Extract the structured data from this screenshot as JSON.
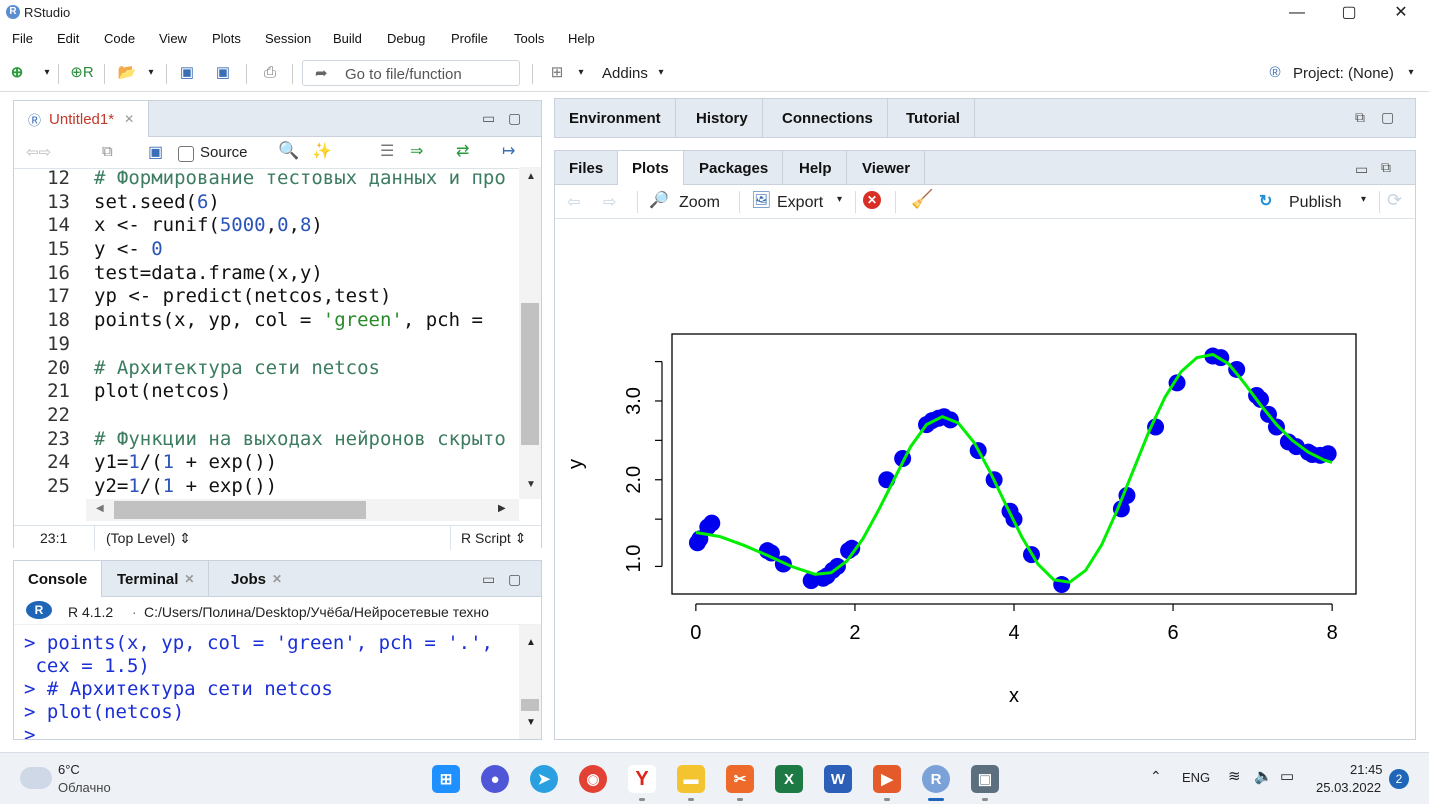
{
  "app": {
    "title": "RStudio",
    "logo_letter": "R"
  },
  "window_controls": {
    "minimize": "—",
    "maximize": "▢",
    "close": "✕"
  },
  "menu": [
    "File",
    "Edit",
    "Code",
    "View",
    "Plots",
    "Session",
    "Build",
    "Debug",
    "Profile",
    "Tools",
    "Help"
  ],
  "toolbar": {
    "goto_placeholder": "Go to file/function",
    "addins_label": "Addins",
    "project_label": "Project: (None)"
  },
  "editor": {
    "tab_label": "Untitled1*",
    "source_checkbox_label": "Source",
    "lines": [
      {
        "n": "12",
        "text": "# Формирование тестовых данных и про"
      },
      {
        "n": "13",
        "text": "set.seed(6)"
      },
      {
        "n": "14",
        "text": "x <- runif(5000,0,8)"
      },
      {
        "n": "15",
        "text": "y <- 0"
      },
      {
        "n": "16",
        "text": "test=data.frame(x,y)"
      },
      {
        "n": "17",
        "text": "yp <- predict(netcos,test)"
      },
      {
        "n": "18",
        "text": "points(x, yp, col = 'green', pch = "
      },
      {
        "n": "19",
        "text": ""
      },
      {
        "n": "20",
        "text": "# Архитектура сети netcos"
      },
      {
        "n": "21",
        "text": "plot(netcos)"
      },
      {
        "n": "22",
        "text": ""
      },
      {
        "n": "23",
        "text": "# Функции на выходах нейронов скрыто"
      },
      {
        "n": "24",
        "text": "y1=1/(1 + exp())"
      },
      {
        "n": "25",
        "text": "y2=1/(1 + exp())"
      },
      {
        "n": "26",
        "text": ""
      }
    ],
    "status_position": "23:1",
    "status_scope": "(Top Level) ⇕",
    "status_type": "R Script ⇕"
  },
  "console": {
    "tabs": [
      "Console",
      "Terminal",
      "Jobs"
    ],
    "r_version": "R 4.1.2",
    "path": "C:/Users/Полина/Desktop/Учёба/Нейросетевые техно",
    "lines": [
      "> points(x, yp, col = 'green', pch = '.',",
      " cex = 1.5)",
      "> # Архитектура сети netcos",
      "> plot(netcos)",
      ">"
    ]
  },
  "env_tabs": [
    "Environment",
    "History",
    "Connections",
    "Tutorial"
  ],
  "plot_tabs": [
    "Files",
    "Plots",
    "Packages",
    "Help",
    "Viewer"
  ],
  "plot_toolbar": {
    "zoom": "Zoom",
    "export": "Export",
    "publish": "Publish"
  },
  "chart_data": {
    "type": "scatter",
    "xlabel": "x",
    "ylabel": "y",
    "xlim": [
      -0.3,
      8.3
    ],
    "ylim": [
      0.55,
      3.85
    ],
    "xticks": [
      "0",
      "2",
      "4",
      "6",
      "8"
    ],
    "yticks": [
      "1.0",
      "2.0",
      "3.0"
    ],
    "point_color": "#0000ee",
    "line_color": "#00ee00",
    "series": [
      {
        "type": "scatter",
        "points": [
          [
            0.02,
            1.2
          ],
          [
            0.05,
            1.25
          ],
          [
            0.15,
            1.4
          ],
          [
            0.2,
            1.45
          ],
          [
            0.9,
            1.1
          ],
          [
            0.95,
            1.07
          ],
          [
            1.1,
            0.93
          ],
          [
            1.45,
            0.72
          ],
          [
            1.6,
            0.75
          ],
          [
            1.65,
            0.78
          ],
          [
            1.72,
            0.85
          ],
          [
            1.78,
            0.9
          ],
          [
            1.92,
            1.1
          ],
          [
            1.96,
            1.13
          ],
          [
            2.4,
            2.0
          ],
          [
            2.6,
            2.27
          ],
          [
            2.9,
            2.7
          ],
          [
            2.97,
            2.75
          ],
          [
            3.05,
            2.78
          ],
          [
            3.12,
            2.8
          ],
          [
            3.2,
            2.76
          ],
          [
            3.55,
            2.37
          ],
          [
            3.75,
            2.0
          ],
          [
            3.95,
            1.6
          ],
          [
            4.0,
            1.5
          ],
          [
            4.22,
            1.05
          ],
          [
            4.6,
            0.67
          ],
          [
            5.35,
            1.63
          ],
          [
            5.42,
            1.8
          ],
          [
            5.78,
            2.67
          ],
          [
            6.05,
            3.23
          ],
          [
            6.5,
            3.57
          ],
          [
            6.6,
            3.55
          ],
          [
            6.8,
            3.4
          ],
          [
            7.05,
            3.07
          ],
          [
            7.1,
            3.02
          ],
          [
            7.2,
            2.83
          ],
          [
            7.3,
            2.67
          ],
          [
            7.45,
            2.48
          ],
          [
            7.55,
            2.42
          ],
          [
            7.7,
            2.35
          ],
          [
            7.75,
            2.32
          ],
          [
            7.85,
            2.31
          ],
          [
            7.95,
            2.33
          ]
        ]
      },
      {
        "type": "line",
        "points": [
          [
            0.0,
            1.33
          ],
          [
            0.3,
            1.28
          ],
          [
            0.6,
            1.17
          ],
          [
            0.9,
            1.04
          ],
          [
            1.2,
            0.9
          ],
          [
            1.5,
            0.8
          ],
          [
            1.7,
            0.82
          ],
          [
            1.9,
            0.97
          ],
          [
            2.1,
            1.25
          ],
          [
            2.3,
            1.62
          ],
          [
            2.5,
            2.02
          ],
          [
            2.7,
            2.42
          ],
          [
            2.9,
            2.7
          ],
          [
            3.1,
            2.8
          ],
          [
            3.3,
            2.72
          ],
          [
            3.5,
            2.47
          ],
          [
            3.7,
            2.1
          ],
          [
            3.9,
            1.68
          ],
          [
            4.1,
            1.27
          ],
          [
            4.3,
            0.93
          ],
          [
            4.5,
            0.73
          ],
          [
            4.7,
            0.7
          ],
          [
            4.9,
            0.85
          ],
          [
            5.1,
            1.17
          ],
          [
            5.3,
            1.62
          ],
          [
            5.5,
            2.12
          ],
          [
            5.7,
            2.62
          ],
          [
            5.9,
            3.05
          ],
          [
            6.1,
            3.37
          ],
          [
            6.3,
            3.55
          ],
          [
            6.5,
            3.59
          ],
          [
            6.7,
            3.47
          ],
          [
            6.9,
            3.22
          ],
          [
            7.1,
            2.95
          ],
          [
            7.3,
            2.7
          ],
          [
            7.5,
            2.5
          ],
          [
            7.7,
            2.35
          ],
          [
            7.9,
            2.25
          ],
          [
            8.0,
            2.22
          ]
        ]
      }
    ]
  },
  "taskbar": {
    "weather_temp": "6°C",
    "weather_desc": "Облачно",
    "lang": "ENG",
    "time": "21:45",
    "date": "25.03.2022",
    "notifications": "2"
  }
}
